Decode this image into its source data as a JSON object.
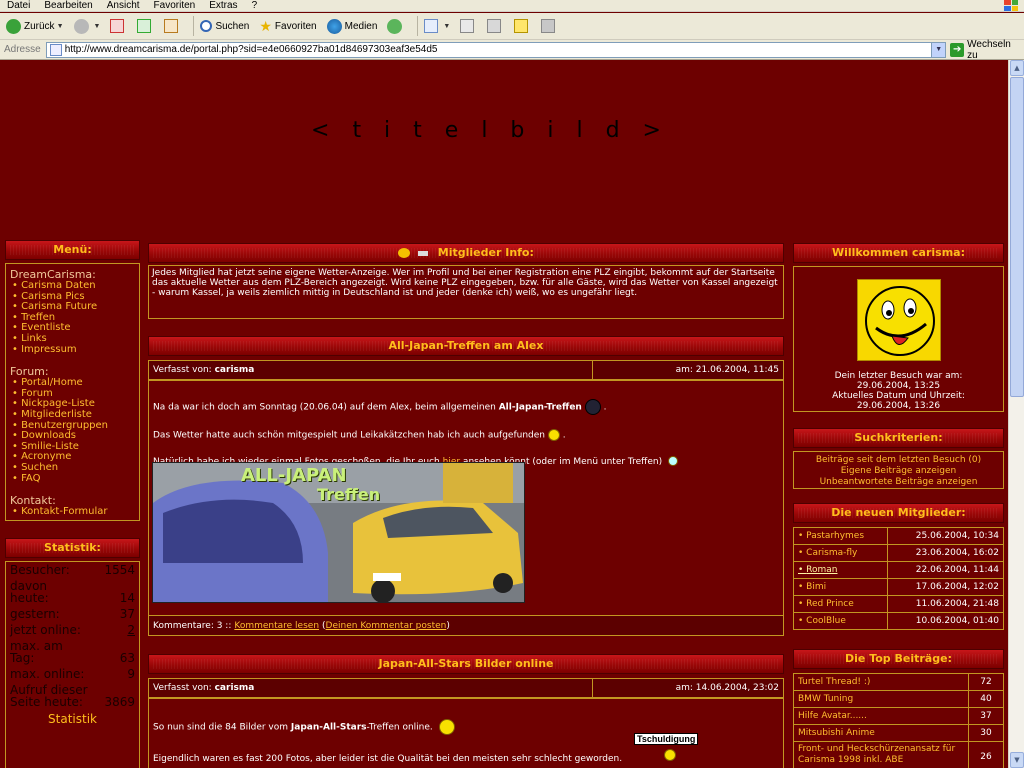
{
  "browser": {
    "menu": [
      "Datei",
      "Bearbeiten",
      "Ansicht",
      "Favoriten",
      "Extras",
      "?"
    ],
    "toolbar": {
      "back": "Zurück",
      "search": "Suchen",
      "favorites": "Favoriten",
      "media": "Medien"
    },
    "address_label": "Adresse",
    "url": "http://www.dreamcarisma.de/portal.php?sid=e4e0660927ba01d84697303eaf3e54d5",
    "go": "Wechseln zu"
  },
  "header": {
    "title_image_placeholder": "< t i t e l b i l d >"
  },
  "menu_panel": {
    "title": "Menü:",
    "sections": [
      {
        "heading": "DreamCarisma:",
        "items": [
          "Carisma Daten",
          "Carisma Pics",
          "Carisma Future",
          "Treffen",
          "Eventliste",
          "Links",
          "Impressum"
        ]
      },
      {
        "heading": "Forum:",
        "items": [
          "Portal/Home",
          "Forum",
          "Nickpage-Liste",
          "Mitgliederliste",
          "Benutzergruppen",
          "Downloads",
          "Smilie-Liste",
          "Acronyme",
          "Suchen",
          "FAQ"
        ]
      },
      {
        "heading": "Kontakt:",
        "items": [
          "Kontakt-Formular"
        ]
      }
    ]
  },
  "stats_panel": {
    "title": "Statistik:",
    "rows": [
      {
        "label": "Besucher:",
        "value": "1554"
      },
      {
        "label": "davon heute:",
        "value": "14"
      },
      {
        "label": "gestern:",
        "value": "37"
      },
      {
        "label": "jetzt online:",
        "value": "2"
      },
      {
        "label": "max. am Tag:",
        "value": "63"
      },
      {
        "label": "max. online:",
        "value": "9"
      },
      {
        "label": "Aufruf dieser Seite heute:",
        "value": "3869"
      }
    ],
    "footer_text": "Statistik"
  },
  "info_panel": {
    "title": "Mitglieder Info:",
    "text": "Jedes Mitglied hat jetzt seine eigene Wetter-Anzeige. Wer im Profil und bei einer Registration eine PLZ eingibt, bekommt auf der Startseite das aktuelle Wetter aus dem PLZ-Bereich angezeigt. Wird keine PLZ eingegeben, bzw. für alle Gäste, wird das Wetter von Kassel angezeigt - warum Kassel, ja weils ziemlich mittig in Deutschland ist und jeder (denke ich) weiß, wo es ungefähr liegt."
  },
  "posts": [
    {
      "title": "All-Japan-Treffen am Alex",
      "author_label": "Verfasst von:",
      "author": "carisma",
      "date": "am: 21.06.2004, 11:45",
      "p1_pre": "Na da war ich doch am Sonntag (20.06.04) auf dem Alex, beim allgemeinen ",
      "p1_bold": "All-Japan-Treffen",
      "p2": "Das Wetter hatte auch schön mitgespielt und Leikakätzchen hab ich auch aufgefunden",
      "p3_pre": "Natürlich habe ich wieder einmal Fotos geschoßen, die Ihr euch ",
      "p3_link": "hier",
      "p3_post": " ansehen könnt (oder im Menü unter Treffen)",
      "image_title_1": "ALL-JAPAN",
      "image_title_2": "Treffen",
      "comments_label": "Kommentare: 3 ::",
      "comments_link": "Kommentare lesen",
      "comment_post_link": "Deinen Kommentar posten"
    },
    {
      "title": "Japan-All-Stars Bilder online",
      "author_label": "Verfasst von:",
      "author": "carisma",
      "date": "am: 14.06.2004, 23:02",
      "p1_pre": "So nun sind die 84 Bilder vom ",
      "p1_bold": "Japan-All-Stars",
      "p1_post": "-Treffen online.",
      "p2": "Eigendlich waren es fast 200 Fotos, aber leider ist die Qualität bei den meisten sehr schlecht geworden."
    }
  ],
  "tooltip": "Tschuldigung",
  "welcome_panel": {
    "title": "Willkommen carisma:",
    "last_visit_label": "Dein letzter Besuch war am:",
    "last_visit": "29.06.2004, 13:25",
    "now_label": "Aktuelles Datum und Uhrzeit:",
    "now": "29.06.2004, 13:26"
  },
  "search_panel": {
    "title": "Suchkriterien:",
    "links": [
      "Beiträge seit dem letzten Besuch (0)",
      "Eigene Beiträge anzeigen",
      "Unbeantwortete Beiträge anzeigen"
    ]
  },
  "new_members_panel": {
    "title": "Die neuen Mitglieder:",
    "rows": [
      {
        "name": "Pastarhymes",
        "date": "25.06.2004, 10:34"
      },
      {
        "name": "Carisma-fly",
        "date": "23.06.2004, 16:02"
      },
      {
        "name": "Roman",
        "date": "22.06.2004, 11:44"
      },
      {
        "name": "Bimi",
        "date": "17.06.2004, 12:02"
      },
      {
        "name": "Red Prince",
        "date": "11.06.2004, 21:48"
      },
      {
        "name": "CoolBlue",
        "date": "10.06.2004, 01:40"
      }
    ]
  },
  "top_posts_panel": {
    "title": "Die Top Beiträge:",
    "rows": [
      {
        "title": "Turtel Thread! :)",
        "count": "72"
      },
      {
        "title": "BMW Tuning",
        "count": "40"
      },
      {
        "title": "Hilfe Avatar......",
        "count": "37"
      },
      {
        "title": "Mitsubishi Anime",
        "count": "30"
      },
      {
        "title": "Front- und Heckschürzenansatz für Carisma 1998 inkl. ABE",
        "count": "26"
      }
    ]
  },
  "colors": {
    "page_bg": "#6d0000",
    "accent": "#ffbe1c",
    "border": "#c29722",
    "text": "#ffffff"
  }
}
